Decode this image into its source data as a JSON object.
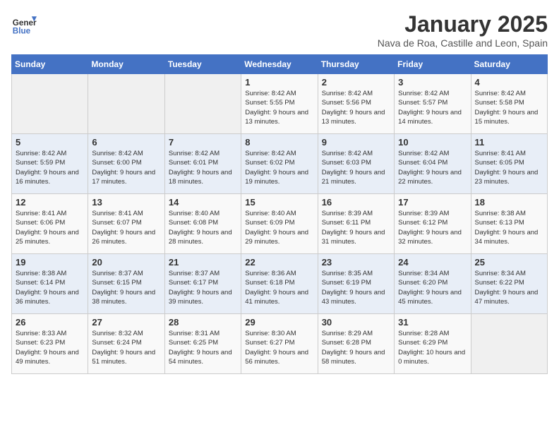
{
  "app": {
    "name": "GeneralBlue",
    "logo_line1": "General",
    "logo_line2": "Blue"
  },
  "calendar": {
    "title": "January 2025",
    "subtitle": "Nava de Roa, Castille and Leon, Spain",
    "days_of_week": [
      "Sunday",
      "Monday",
      "Tuesday",
      "Wednesday",
      "Thursday",
      "Friday",
      "Saturday"
    ],
    "weeks": [
      {
        "days": [
          {
            "number": "",
            "info": ""
          },
          {
            "number": "",
            "info": ""
          },
          {
            "number": "",
            "info": ""
          },
          {
            "number": "1",
            "info": "Sunrise: 8:42 AM\nSunset: 5:55 PM\nDaylight: 9 hours and 13 minutes."
          },
          {
            "number": "2",
            "info": "Sunrise: 8:42 AM\nSunset: 5:56 PM\nDaylight: 9 hours and 13 minutes."
          },
          {
            "number": "3",
            "info": "Sunrise: 8:42 AM\nSunset: 5:57 PM\nDaylight: 9 hours and 14 minutes."
          },
          {
            "number": "4",
            "info": "Sunrise: 8:42 AM\nSunset: 5:58 PM\nDaylight: 9 hours and 15 minutes."
          }
        ]
      },
      {
        "days": [
          {
            "number": "5",
            "info": "Sunrise: 8:42 AM\nSunset: 5:59 PM\nDaylight: 9 hours and 16 minutes."
          },
          {
            "number": "6",
            "info": "Sunrise: 8:42 AM\nSunset: 6:00 PM\nDaylight: 9 hours and 17 minutes."
          },
          {
            "number": "7",
            "info": "Sunrise: 8:42 AM\nSunset: 6:01 PM\nDaylight: 9 hours and 18 minutes."
          },
          {
            "number": "8",
            "info": "Sunrise: 8:42 AM\nSunset: 6:02 PM\nDaylight: 9 hours and 19 minutes."
          },
          {
            "number": "9",
            "info": "Sunrise: 8:42 AM\nSunset: 6:03 PM\nDaylight: 9 hours and 21 minutes."
          },
          {
            "number": "10",
            "info": "Sunrise: 8:42 AM\nSunset: 6:04 PM\nDaylight: 9 hours and 22 minutes."
          },
          {
            "number": "11",
            "info": "Sunrise: 8:41 AM\nSunset: 6:05 PM\nDaylight: 9 hours and 23 minutes."
          }
        ]
      },
      {
        "days": [
          {
            "number": "12",
            "info": "Sunrise: 8:41 AM\nSunset: 6:06 PM\nDaylight: 9 hours and 25 minutes."
          },
          {
            "number": "13",
            "info": "Sunrise: 8:41 AM\nSunset: 6:07 PM\nDaylight: 9 hours and 26 minutes."
          },
          {
            "number": "14",
            "info": "Sunrise: 8:40 AM\nSunset: 6:08 PM\nDaylight: 9 hours and 28 minutes."
          },
          {
            "number": "15",
            "info": "Sunrise: 8:40 AM\nSunset: 6:09 PM\nDaylight: 9 hours and 29 minutes."
          },
          {
            "number": "16",
            "info": "Sunrise: 8:39 AM\nSunset: 6:11 PM\nDaylight: 9 hours and 31 minutes."
          },
          {
            "number": "17",
            "info": "Sunrise: 8:39 AM\nSunset: 6:12 PM\nDaylight: 9 hours and 32 minutes."
          },
          {
            "number": "18",
            "info": "Sunrise: 8:38 AM\nSunset: 6:13 PM\nDaylight: 9 hours and 34 minutes."
          }
        ]
      },
      {
        "days": [
          {
            "number": "19",
            "info": "Sunrise: 8:38 AM\nSunset: 6:14 PM\nDaylight: 9 hours and 36 minutes."
          },
          {
            "number": "20",
            "info": "Sunrise: 8:37 AM\nSunset: 6:15 PM\nDaylight: 9 hours and 38 minutes."
          },
          {
            "number": "21",
            "info": "Sunrise: 8:37 AM\nSunset: 6:17 PM\nDaylight: 9 hours and 39 minutes."
          },
          {
            "number": "22",
            "info": "Sunrise: 8:36 AM\nSunset: 6:18 PM\nDaylight: 9 hours and 41 minutes."
          },
          {
            "number": "23",
            "info": "Sunrise: 8:35 AM\nSunset: 6:19 PM\nDaylight: 9 hours and 43 minutes."
          },
          {
            "number": "24",
            "info": "Sunrise: 8:34 AM\nSunset: 6:20 PM\nDaylight: 9 hours and 45 minutes."
          },
          {
            "number": "25",
            "info": "Sunrise: 8:34 AM\nSunset: 6:22 PM\nDaylight: 9 hours and 47 minutes."
          }
        ]
      },
      {
        "days": [
          {
            "number": "26",
            "info": "Sunrise: 8:33 AM\nSunset: 6:23 PM\nDaylight: 9 hours and 49 minutes."
          },
          {
            "number": "27",
            "info": "Sunrise: 8:32 AM\nSunset: 6:24 PM\nDaylight: 9 hours and 51 minutes."
          },
          {
            "number": "28",
            "info": "Sunrise: 8:31 AM\nSunset: 6:25 PM\nDaylight: 9 hours and 54 minutes."
          },
          {
            "number": "29",
            "info": "Sunrise: 8:30 AM\nSunset: 6:27 PM\nDaylight: 9 hours and 56 minutes."
          },
          {
            "number": "30",
            "info": "Sunrise: 8:29 AM\nSunset: 6:28 PM\nDaylight: 9 hours and 58 minutes."
          },
          {
            "number": "31",
            "info": "Sunrise: 8:28 AM\nSunset: 6:29 PM\nDaylight: 10 hours and 0 minutes."
          },
          {
            "number": "",
            "info": ""
          }
        ]
      }
    ]
  }
}
